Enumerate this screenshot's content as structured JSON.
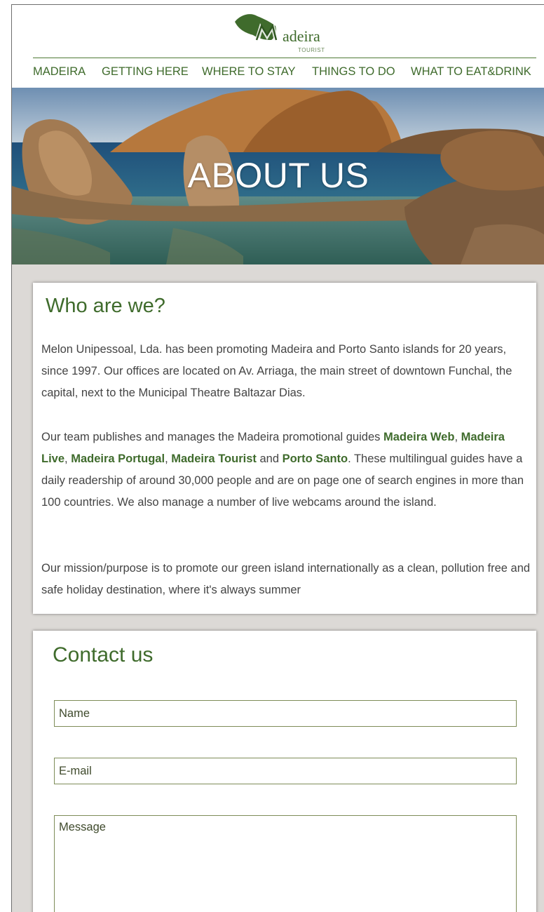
{
  "brand": {
    "name": "adeira",
    "tagline": "TOURIST",
    "accent_color": "#3f6b2c"
  },
  "nav": {
    "items": [
      {
        "label": "MADEIRA"
      },
      {
        "label": "GETTING HERE"
      },
      {
        "label": "WHERE TO STAY"
      },
      {
        "label": "THINGS TO DO"
      },
      {
        "label": "WHAT TO EAT&DRINK"
      }
    ]
  },
  "hero": {
    "title": "ABOUT US"
  },
  "about": {
    "title": "Who are we?",
    "p1": "Melon Unipessoal, Lda. has been promoting Madeira and Porto Santo islands for 20 years, since 1997. Our offices are located on Av. Arriaga, the main street of downtown Funchal, the capital, next to the Municipal Theatre Baltazar Dias.",
    "p2": {
      "intro": "Our team publishes and manages the Madeira promotional guides ",
      "links": [
        "Madeira Web",
        "Madeira Live",
        "Madeira Portugal",
        "Madeira Tourist",
        "Porto Santo"
      ],
      "sep1": ", ",
      "sep2": ", ",
      "sep3": ", ",
      "sep4": " and ",
      "rest": ". These multilingual guides have a daily readership of around 30,000 people and are on page one of search engines in more than 100 countries. We also manage a number of live webcams around the island."
    },
    "p3": "Our mission/purpose is to promote our green island internationally as a clean, pollution free and safe holiday destination, where it's always summer"
  },
  "contact": {
    "title": "Contact us",
    "name_placeholder": "Name",
    "email_placeholder": "E-mail",
    "message_placeholder": "Message"
  }
}
